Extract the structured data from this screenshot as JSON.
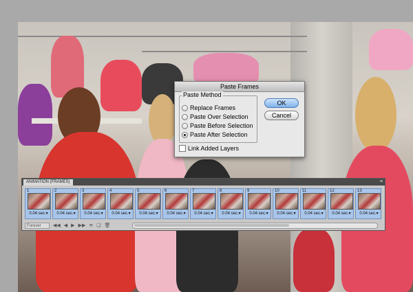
{
  "dialog": {
    "title": "Paste Frames",
    "group_label": "Paste Method",
    "options": [
      {
        "label": "Replace Frames",
        "selected": false
      },
      {
        "label": "Paste Over Selection",
        "selected": false
      },
      {
        "label": "Paste Before Selection",
        "selected": false
      },
      {
        "label": "Paste After Selection",
        "selected": true
      }
    ],
    "link_layers_label": "Link Added Layers",
    "link_layers_checked": false,
    "ok_label": "OK",
    "cancel_label": "Cancel"
  },
  "panel": {
    "tab_label": "ANIMATION (FRAMES)",
    "menu_icon": "panel-menu-icon",
    "frames": [
      {
        "num": "1",
        "delay": "0.04 sec."
      },
      {
        "num": "2",
        "delay": "0.04 sec."
      },
      {
        "num": "3",
        "delay": "0.04 sec."
      },
      {
        "num": "4",
        "delay": "0.04 sec."
      },
      {
        "num": "5",
        "delay": "0.04 sec."
      },
      {
        "num": "6",
        "delay": "0.04 sec."
      },
      {
        "num": "7",
        "delay": "0.04 sec."
      },
      {
        "num": "8",
        "delay": "0.04 sec."
      },
      {
        "num": "9",
        "delay": "0.04 sec."
      },
      {
        "num": "10",
        "delay": "0.04 sec."
      },
      {
        "num": "11",
        "delay": "0.04 sec."
      },
      {
        "num": "12",
        "delay": "0.04 sec."
      },
      {
        "num": "13",
        "delay": "0.04 sec."
      }
    ],
    "loop_label": "Forever",
    "controls": [
      "first-frame-icon",
      "prev-frame-icon",
      "play-icon",
      "next-frame-icon",
      "tween-icon",
      "duplicate-frame-icon",
      "delete-frame-icon"
    ]
  },
  "colors": {
    "frame_selected": "#a9c6ea",
    "ok_button": "#7fb2ea"
  }
}
